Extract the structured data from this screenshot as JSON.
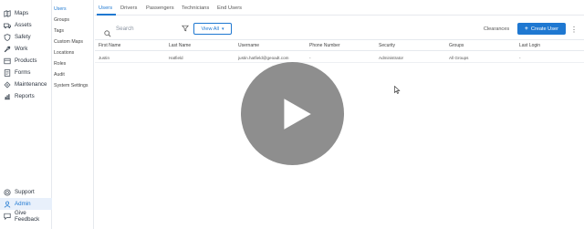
{
  "nav": {
    "items": [
      {
        "label": "Maps",
        "icon": "map-icon"
      },
      {
        "label": "Assets",
        "icon": "truck-icon"
      },
      {
        "label": "Safety",
        "icon": "shield-icon"
      },
      {
        "label": "Work",
        "icon": "wrench-icon"
      },
      {
        "label": "Products",
        "icon": "box-icon"
      },
      {
        "label": "Forms",
        "icon": "form-icon"
      },
      {
        "label": "Maintenance",
        "icon": "gear-icon"
      },
      {
        "label": "Reports",
        "icon": "chart-icon"
      }
    ],
    "bottom": [
      {
        "label": "Support",
        "icon": "help-icon"
      },
      {
        "label": "Admin",
        "icon": "user-icon"
      },
      {
        "label": "Give Feedback",
        "icon": "feedback-icon"
      }
    ]
  },
  "submenu": {
    "items": [
      "Users",
      "Groups",
      "Tags",
      "Custom Maps",
      "Locations",
      "Roles",
      "Audit",
      "System Settings"
    ]
  },
  "tabs": [
    "Users",
    "Drivers",
    "Passengers",
    "Technicians",
    "End Users"
  ],
  "toolbar": {
    "search_placeholder": "Search",
    "view_all": "View All",
    "clearances": "Clearances",
    "create_user": "Create User"
  },
  "table": {
    "headers": [
      "First Name",
      "Last Name",
      "Username",
      "Phone Number",
      "Security",
      "Groups",
      "Last Login"
    ],
    "rows": [
      [
        "Justin",
        "Hatfield",
        "justin.hatfield@geoadt.com",
        "-",
        "Administrator",
        "All Groups",
        "-"
      ]
    ]
  },
  "colors": {
    "accent": "#1f78d1",
    "active_bg": "#e8f0fb"
  }
}
